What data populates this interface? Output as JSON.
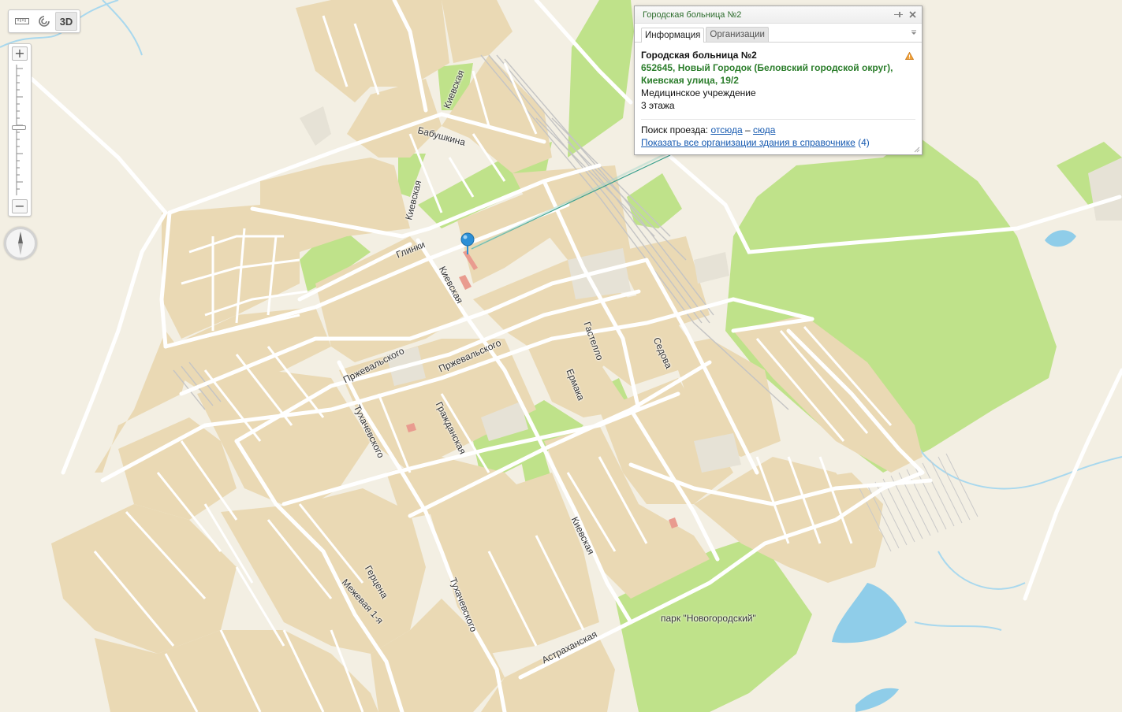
{
  "toolbar": {
    "items": [
      {
        "name": "ruler-icon"
      },
      {
        "name": "layers-icon"
      },
      {
        "name": "3d-toggle",
        "label": "3D"
      }
    ]
  },
  "zoom": {
    "plus": "+",
    "minus": "−",
    "level_fraction": 0.45
  },
  "balloon": {
    "title": "Городская больница №2",
    "tabs": [
      {
        "label": "Информация",
        "active": true
      },
      {
        "label": "Организации",
        "active": false
      }
    ],
    "org_name": "Городская больница №2",
    "address": "652645, Новый Городок (Беловский городской округ), Киевская улица, 19/2",
    "type": "Медицинское учреждение",
    "floors": "3 этажа",
    "route_label": "Поиск проезда:",
    "route_from": "отсюда",
    "route_sep": "–",
    "route_to": "сюда",
    "show_all": "Показать все организации здания в справочнике",
    "show_all_count": "(4)"
  },
  "map": {
    "colors": {
      "background": "#f3efe3",
      "block": "#ead9b4",
      "road": "#ffffff",
      "green": "#bfe28a",
      "water": "#8fcde9",
      "rail": "#cfcfcf",
      "building": "#e5e1d5",
      "pin": "#2c8fd6"
    },
    "streets": [
      "Киевская",
      "Бабушкина",
      "Киевская",
      "Глинки",
      "Киевская",
      "Пржевальского",
      "Пржевальского",
      "Гастелло",
      "Седова",
      "Ермака",
      "Гражданская",
      "Тухачевского",
      "Киевская",
      "Герцена",
      "Межевая 1-я",
      "Тухачевского",
      "Астраханская"
    ],
    "park": "парк \"Новогородский\""
  }
}
